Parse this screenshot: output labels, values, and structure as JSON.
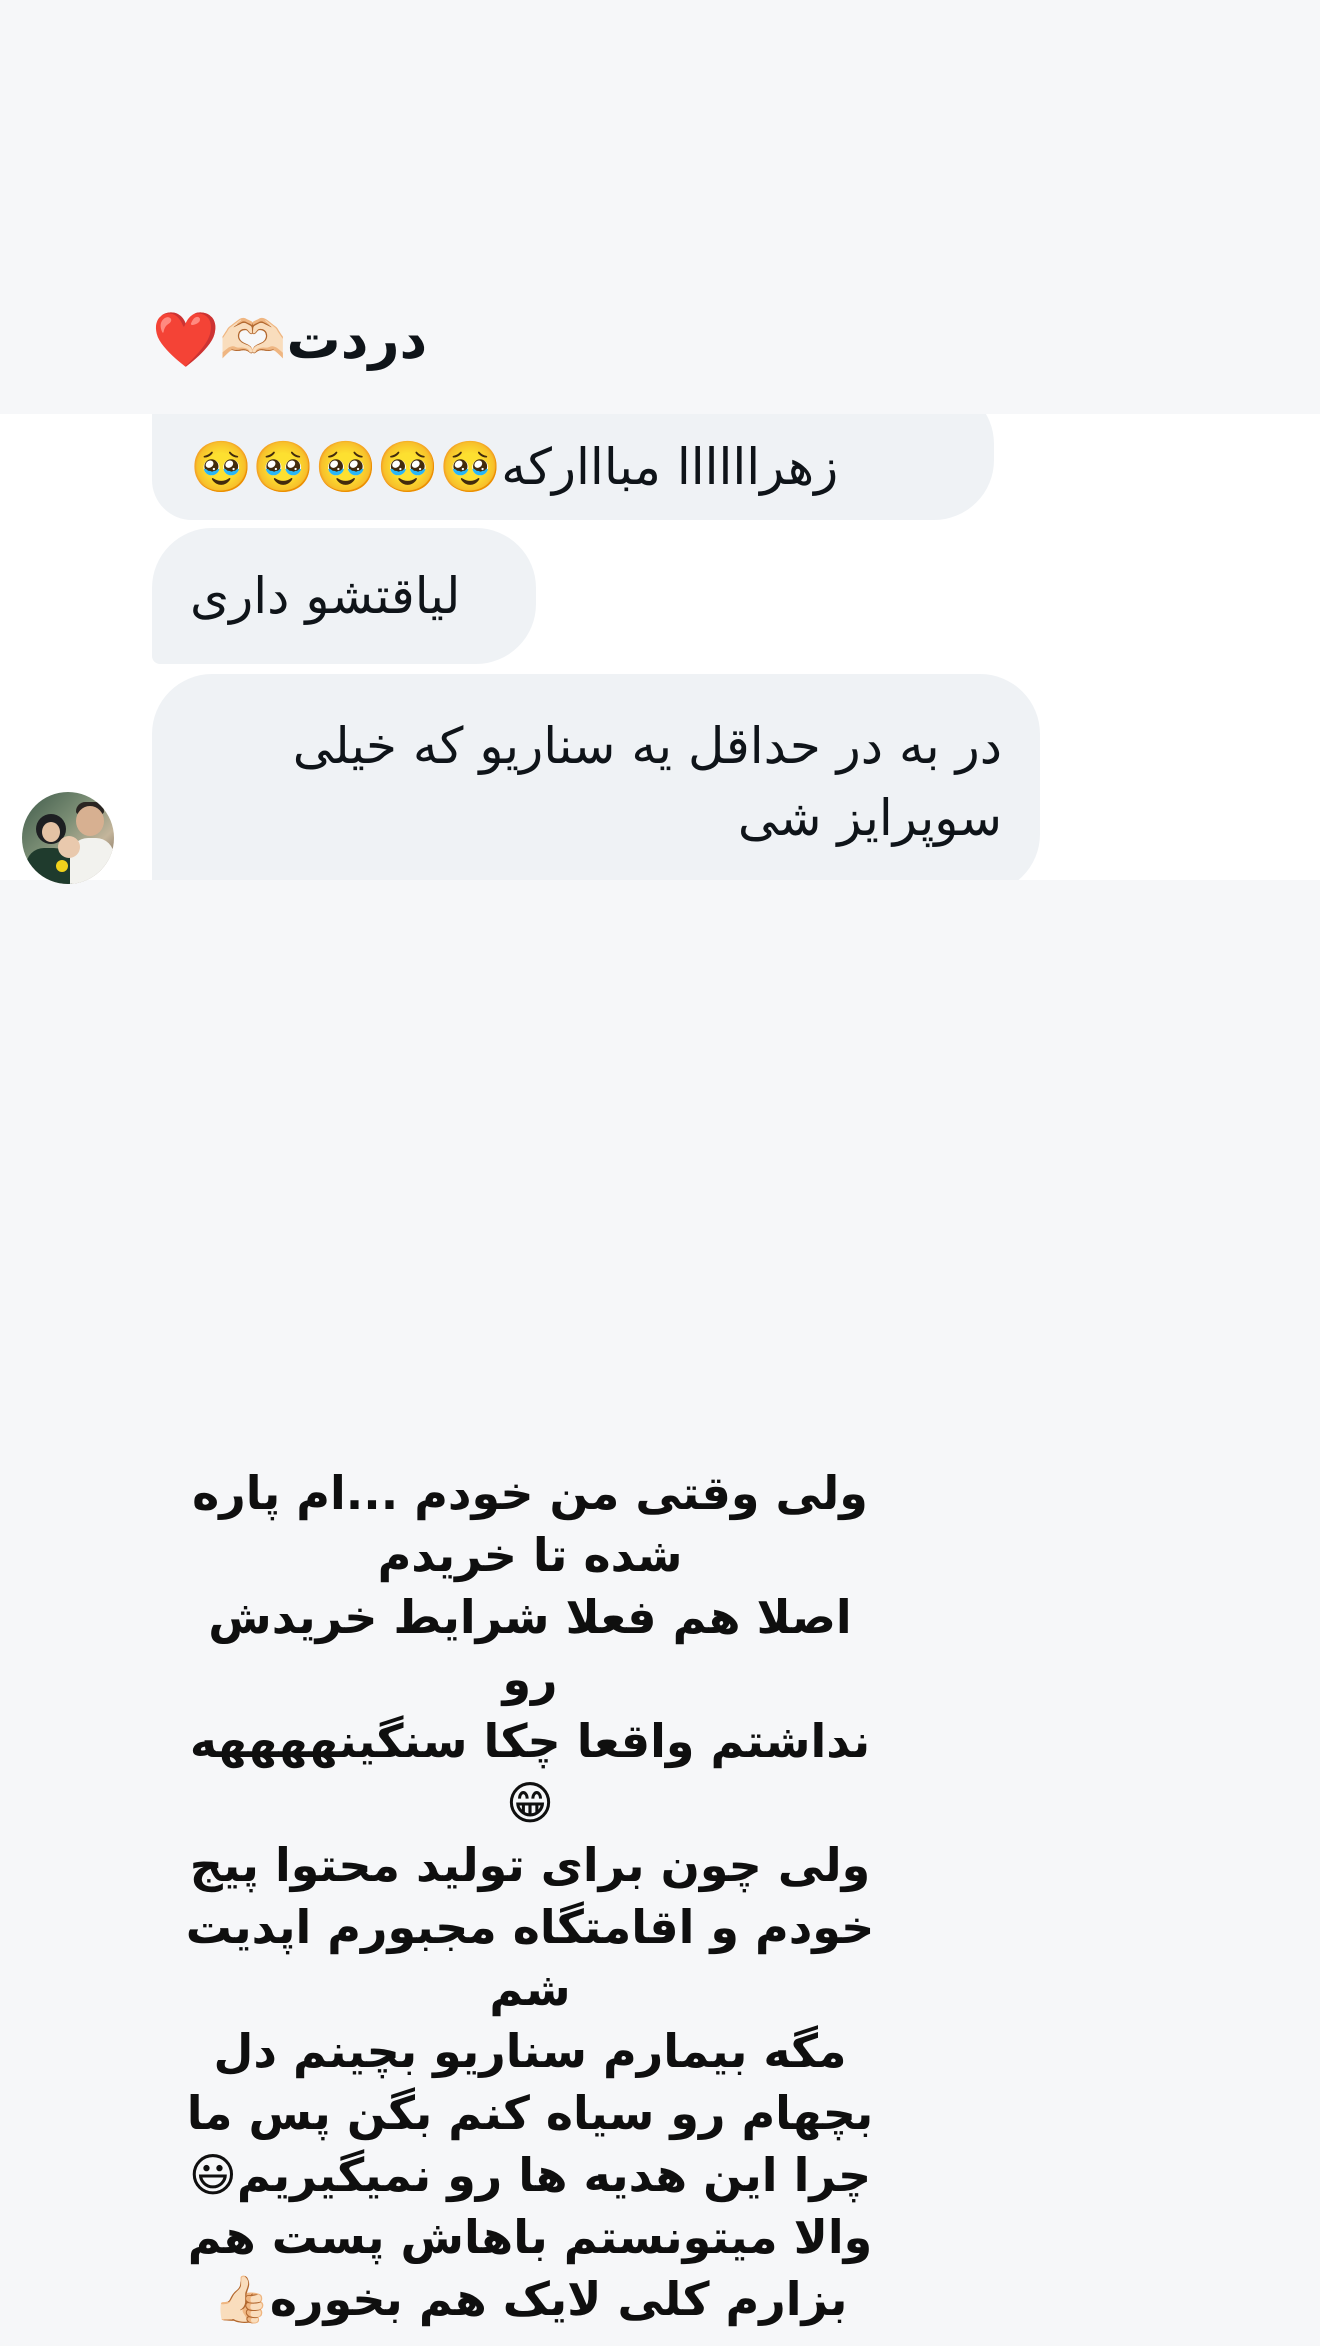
{
  "reply_preview": {
    "text": "دردت🫶🏻❤️"
  },
  "messages": [
    {
      "text": "زهراااااا مبااارکه🥹🥹🥹🥹🥹"
    },
    {
      "text": "لیاقتشو داری"
    },
    {
      "lines": [
        "در به در حداقل یه سناریو که خیلی",
        "سوپرایز شی"
      ]
    }
  ],
  "story": {
    "text": "ولی وقتی من خودم ...ام پاره\nشده تا خریدم\nاصلا هم فعلا شرایط خریدش رو\nنداشتم واقعا چکا سنگینههههه😁\nولی چون برای تولید محتوا پیج\nخودم و اقامتگاه مجبورم اپدیت\nشم\nمگه بیمارم سناریو بچینم دل\nبچهام رو سیاه کنم بگن پس ما\nچرا این هدیه ها رو نمیگیریم😃\nوالا میتونستم باهاش پست هم\nبزارم کلی لایک هم بخوره👍🏻"
  }
}
